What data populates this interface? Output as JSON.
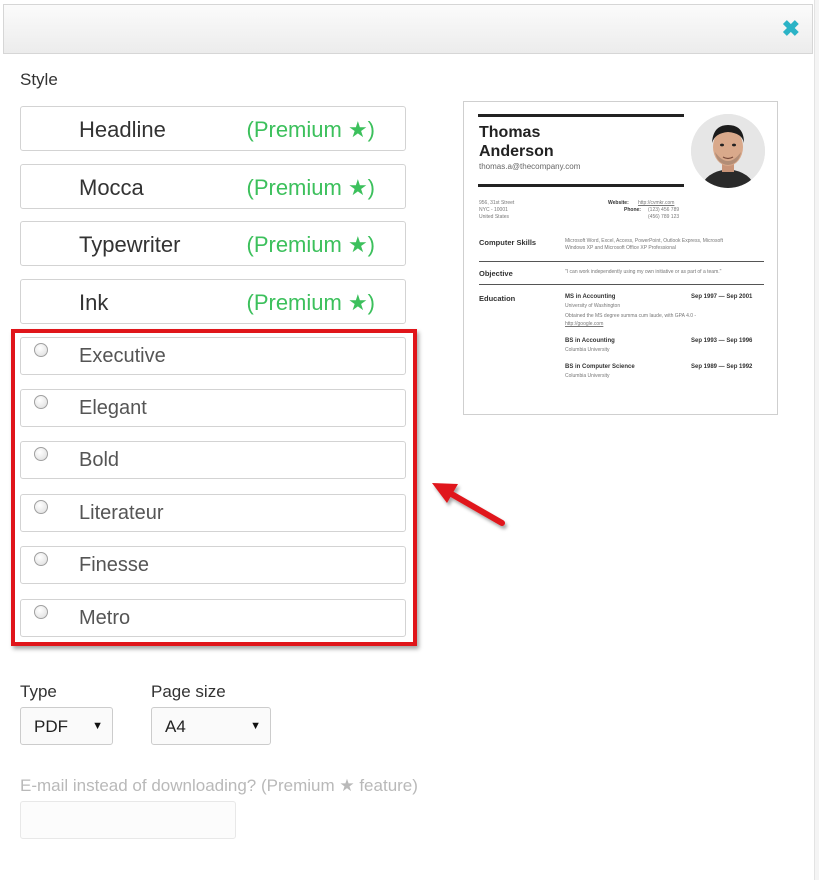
{
  "header": {
    "close_glyph": "✖"
  },
  "style_label": "Style",
  "premium_options": [
    {
      "name": "Headline",
      "tag": "(Premium ★)"
    },
    {
      "name": "Mocca",
      "tag": "(Premium ★)"
    },
    {
      "name": "Typewriter",
      "tag": "(Premium ★)"
    },
    {
      "name": "Ink",
      "tag": "(Premium ★)"
    }
  ],
  "free_options": [
    {
      "name": "Executive"
    },
    {
      "name": "Elegant"
    },
    {
      "name": "Bold"
    },
    {
      "name": "Literateur"
    },
    {
      "name": "Finesse"
    },
    {
      "name": "Metro"
    }
  ],
  "type": {
    "label": "Type",
    "selected": "PDF"
  },
  "page_size": {
    "label": "Page size",
    "selected": "A4"
  },
  "email": {
    "label": "E-mail instead of downloading? (Premium ★ feature)",
    "value": ""
  },
  "colors": {
    "premium_green": "#3cc05c",
    "highlight_red": "#e0151a",
    "close_teal": "#2bb3c6"
  },
  "preview": {
    "first_name": "Thomas",
    "last_name": "Anderson",
    "email": "thomas.a@thecompany.com",
    "address": [
      "956, 31st Street",
      "NYC - 10001",
      "United States"
    ],
    "website_label": "Website:",
    "website": "http://cvmkr.com",
    "phone_label": "Phone:",
    "phones": [
      "(123) 456 789",
      "(456) 789 123"
    ],
    "skills_title": "Computer Skills",
    "skills_text": [
      "Microsoft Word, Excel, Access, PowerPoint, Outlook Express, Microsoft",
      "Windows XP and Microsoft Office XP Professional"
    ],
    "objective_title": "Objective",
    "objective_text": "\"I can work independently using my own initiative or as part of a team.\"",
    "education_title": "Education",
    "education": [
      {
        "degree": "MS in Accounting",
        "dates": "Sep 1997 — Sep 2001",
        "school": "University of Washington",
        "note": "Obtained the MS degree summa cum laude, with GPA 4.0 -",
        "link": "http://google.com"
      },
      {
        "degree": "BS in Accounting",
        "dates": "Sep 1993 — Sep 1996",
        "school": "Columbia University"
      },
      {
        "degree": "BS in Computer Science",
        "dates": "Sep 1989 — Sep 1992",
        "school": "Columbia University"
      }
    ]
  }
}
